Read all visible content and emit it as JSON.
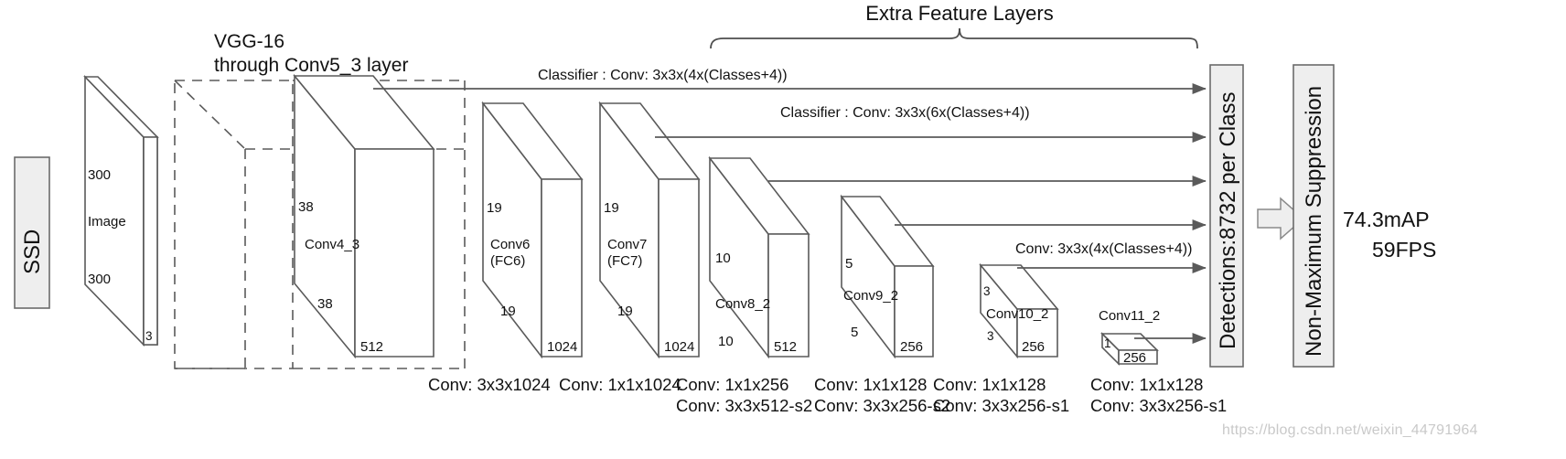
{
  "figure": {
    "title_left": "SSD",
    "vgg_label_line1": "VGG-16",
    "vgg_label_line2": "through Conv5_3 layer",
    "extra_feature_layers": "Extra Feature Layers",
    "detections_label": "Detections:8732  per Class",
    "nms_label": "Non-Maximum Suppression",
    "metric_line1": "74.3mAP",
    "metric_line2": "59FPS",
    "watermark": "https://blog.csdn.net/weixin_44791964"
  },
  "classifiers": [
    {
      "id": "classifier-4box",
      "text": "Classifier : Conv: 3x3x(4x(Classes+4))"
    },
    {
      "id": "classifier-6box",
      "text": "Classifier : Conv: 3x3x(6x(Classes+4))"
    },
    {
      "id": "conv-4box-late",
      "text": "Conv: 3x3x(4x(Classes+4))"
    }
  ],
  "input": {
    "name": "Image",
    "height": "300",
    "width": "300",
    "depth": "3"
  },
  "blocks": [
    {
      "name": "Conv4_3",
      "dim_top": "38",
      "dim_bottom": "38",
      "channels": "512",
      "captions": [
        "Conv: 3x3x1024"
      ]
    },
    {
      "name_line1": "Conv6",
      "name_line2": "(FC6)",
      "dim_top": "19",
      "dim_bottom": "19",
      "channels": "1024",
      "captions": [
        "Conv: 1x1x1024"
      ]
    },
    {
      "name_line1": "Conv7",
      "name_line2": "(FC7)",
      "dim_top": "19",
      "dim_bottom": "19",
      "channels": "1024",
      "captions": [
        "Conv: 1x1x256",
        "Conv:  3x3x512-s2"
      ]
    },
    {
      "name": "Conv8_2",
      "dim_top": "10",
      "dim_bottom": "10",
      "channels": "512",
      "captions": [
        "Conv: 1x1x128",
        "Conv: 3x3x256-s2"
      ]
    },
    {
      "name": "Conv9_2",
      "dim_top": "5",
      "dim_bottom": "5",
      "channels": "256",
      "captions": [
        "Conv: 1x1x128",
        "Conv: 3x3x256-s1"
      ]
    },
    {
      "name": "Conv10_2",
      "dim_top": "3",
      "dim_bottom": "3",
      "channels": "256",
      "captions": [
        "Conv: 1x1x128",
        "Conv: 3x3x256-s1"
      ]
    },
    {
      "name": "Conv11_2",
      "dim_top": "1",
      "dim_bottom": "",
      "channels": "256",
      "captions": []
    }
  ],
  "colors": {
    "stroke": "#5a5a5a",
    "box_fill": "#eeeeee",
    "text": "#111111",
    "watermark": "#c9c9c9"
  }
}
